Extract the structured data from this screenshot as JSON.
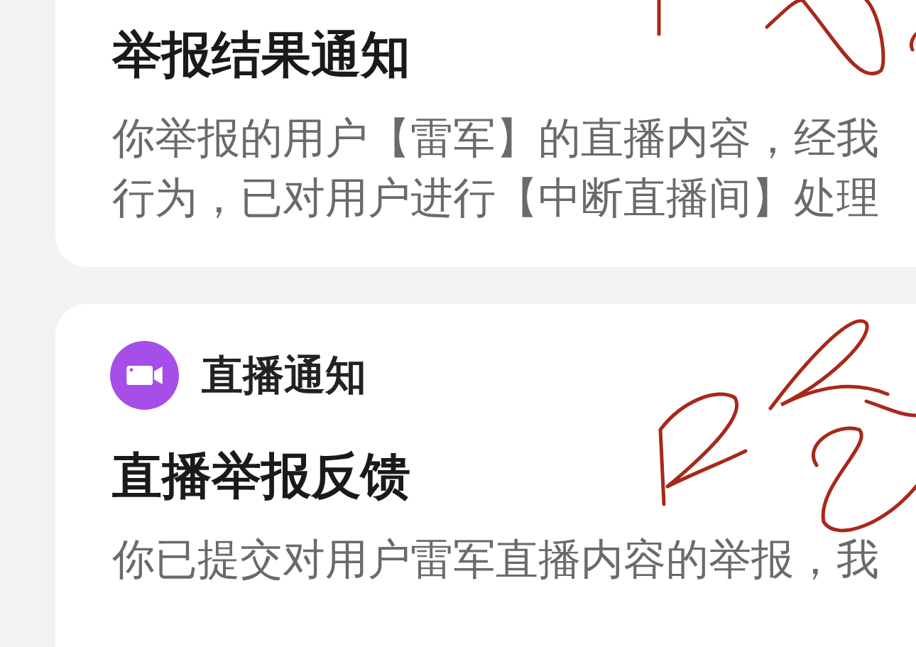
{
  "cards": [
    {
      "kind": "plain",
      "title": "举报结果通知",
      "lines": [
        "你举报的用户【雷军】的直播内容，经我",
        "行为，已对用户进行【中断直播间】处理"
      ]
    },
    {
      "kind": "live",
      "category": "直播通知",
      "title": "直播举报反馈",
      "lines": [
        "你已提交对用户雷军直播内容的举报，我"
      ]
    }
  ]
}
